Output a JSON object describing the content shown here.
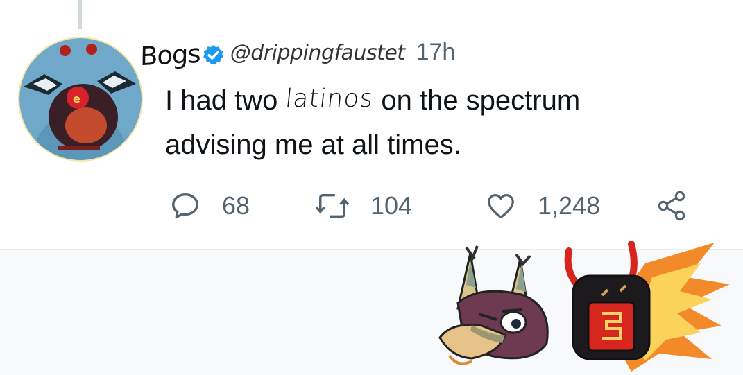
{
  "tweet": {
    "display_name": "Bogs",
    "handle": "@drippingfaustet",
    "time": "17h",
    "text_before": "I had two",
    "text_emphasis": "latinos",
    "text_after_line1": " on the spectrum",
    "text_line2": "advising me at all times."
  },
  "actions": {
    "replies": "68",
    "retweets": "104",
    "likes": "1,248"
  },
  "icons": {
    "avatar": "clown-ball-avatar",
    "verified": "verified-badge-icon",
    "reply": "reply-icon",
    "retweet": "retweet-icon",
    "like": "heart-icon",
    "share": "share-icon"
  },
  "colors": {
    "verified": "#1d9bf0",
    "meta_text": "#536471",
    "body_text": "#0f1419",
    "avatar_blue": "#6fa8c8"
  }
}
